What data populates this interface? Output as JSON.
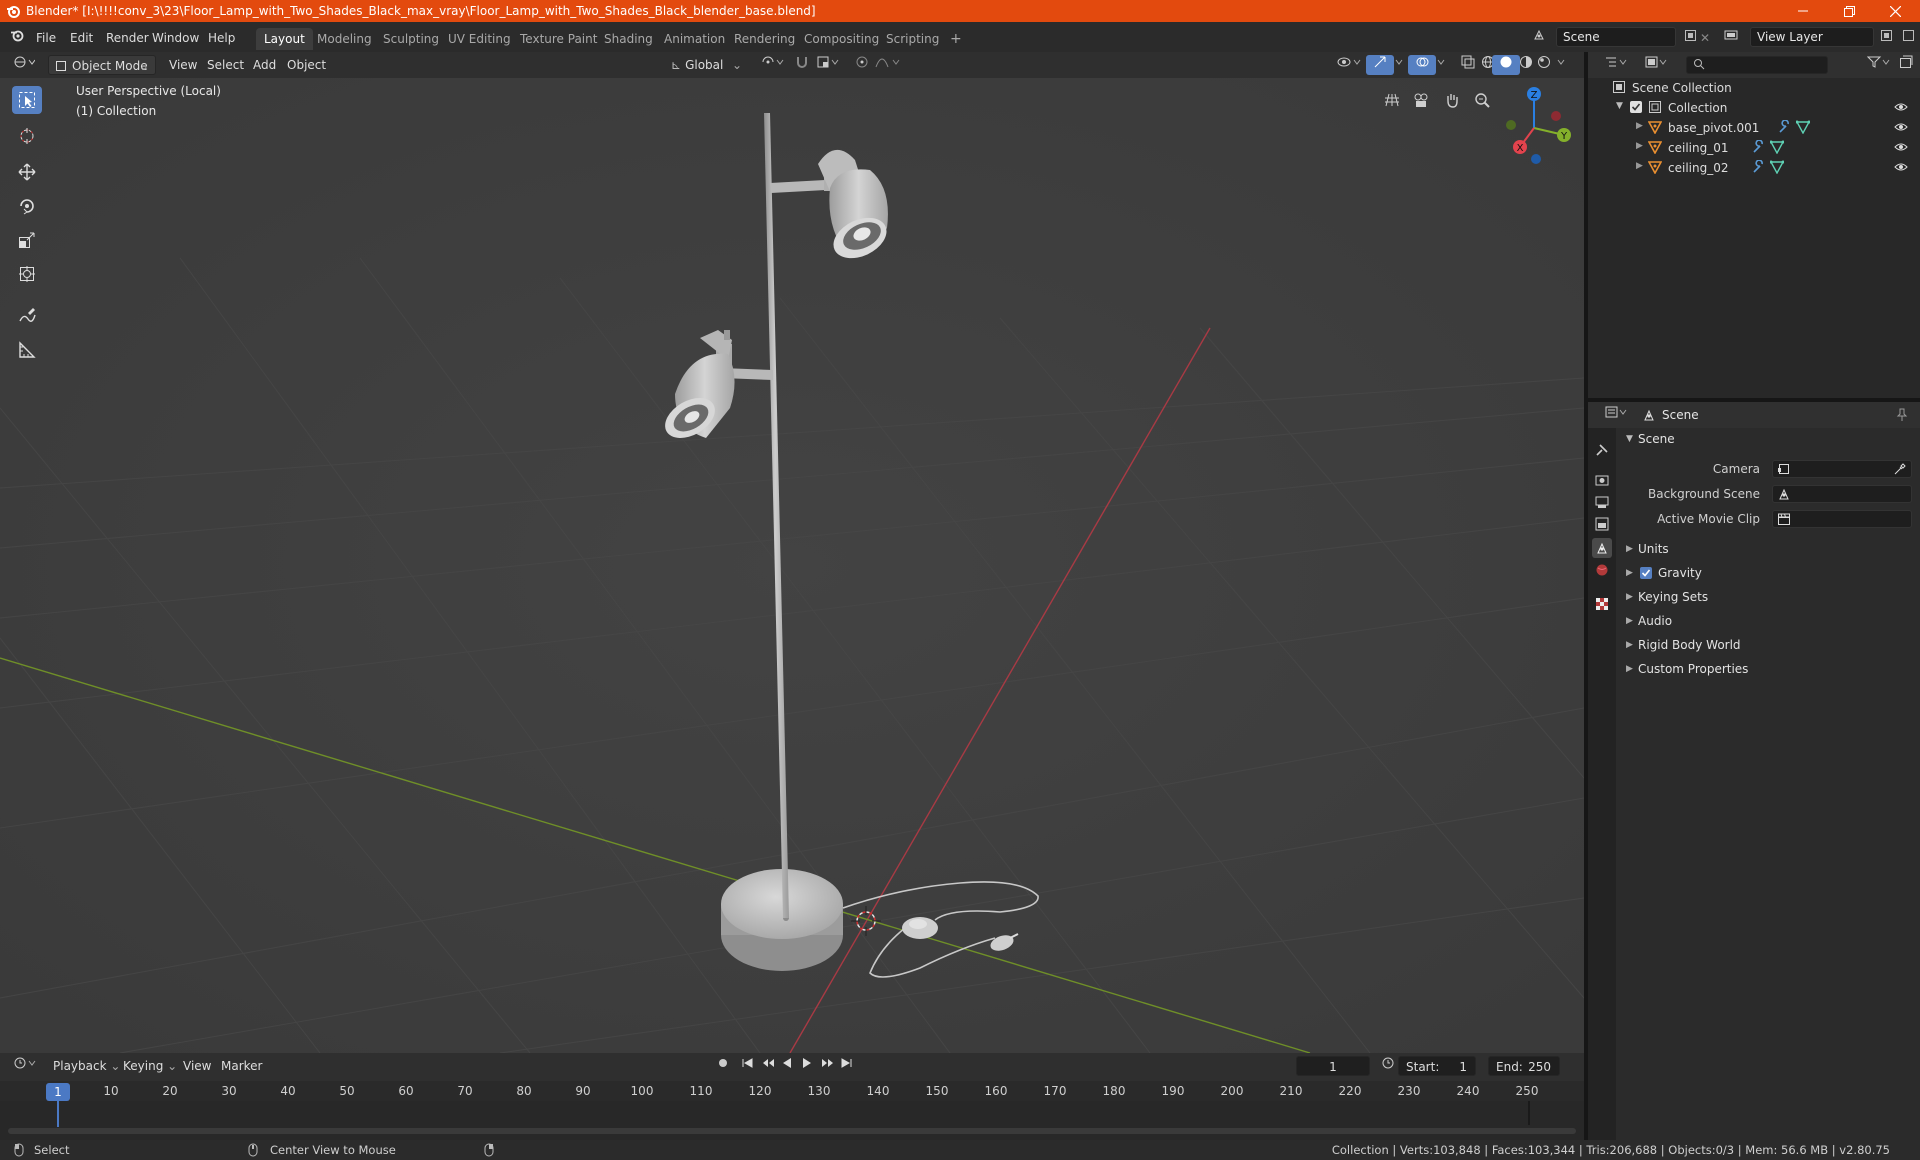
{
  "title": "Blender* [I:\\!!!!conv_3\\23\\Floor_Lamp_with_Two_Shades_Black_max_vray\\Floor_Lamp_with_Two_Shades_Black_blender_base.blend]",
  "menu": [
    "File",
    "Edit",
    "Render",
    "Window",
    "Help"
  ],
  "workspaces": [
    "Layout",
    "Modeling",
    "Sculpting",
    "UV Editing",
    "Texture Paint",
    "Shading",
    "Animation",
    "Rendering",
    "Compositing",
    "Scripting"
  ],
  "add_workspace": "+",
  "scene_field": "Scene",
  "view_layer_field": "View Layer",
  "viewport_header": {
    "mode": "Object Mode",
    "menus": [
      "View",
      "Select",
      "Add",
      "Object"
    ],
    "orientation": "Global"
  },
  "viewport": {
    "perspective": "User Perspective (Local)",
    "collection": "(1) Collection"
  },
  "gizmo": {
    "x": "X",
    "y": "Y",
    "z": "Z"
  },
  "outliner": {
    "root": "Scene Collection",
    "collection": "Collection",
    "objects": [
      "base_pivot.001",
      "ceiling_01",
      "ceiling_02"
    ],
    "search_placeholder": ""
  },
  "properties": {
    "header": "Scene",
    "panel": "Scene",
    "fields": [
      {
        "label": "Camera"
      },
      {
        "label": "Background Scene"
      },
      {
        "label": "Active Movie Clip"
      }
    ],
    "sections": [
      "Units",
      "Gravity",
      "Keying Sets",
      "Audio",
      "Rigid Body World",
      "Custom Properties"
    ],
    "gravity_checked": true
  },
  "timeline": {
    "menus": [
      "Playback",
      "Keying",
      "View",
      "Marker"
    ],
    "current_frame": "1",
    "start_label": "Start:",
    "start": "1",
    "end_label": "End:",
    "end": "250",
    "ticks": [
      "1",
      "10",
      "20",
      "30",
      "40",
      "50",
      "60",
      "70",
      "80",
      "90",
      "100",
      "110",
      "120",
      "130",
      "140",
      "150",
      "160",
      "170",
      "180",
      "190",
      "200",
      "210",
      "220",
      "230",
      "240",
      "250"
    ]
  },
  "status": {
    "left": "Select",
    "middle": "Center View to Mouse",
    "right": "Collection | Verts:103,848 | Faces:103,344 | Tris:206,688 | Objects:0/3 | Mem: 56.6 MB | v2.80.75"
  },
  "colors": {
    "titlebar": "#e34a0e",
    "accent": "#5680c2",
    "axis_x": "#e2434d",
    "axis_y": "#84b02b",
    "axis_z": "#2a7fe2",
    "mesh_icon": "#e98f31",
    "modifier_icon": "#5b9bd5",
    "data_icon": "#5fd1b4"
  }
}
